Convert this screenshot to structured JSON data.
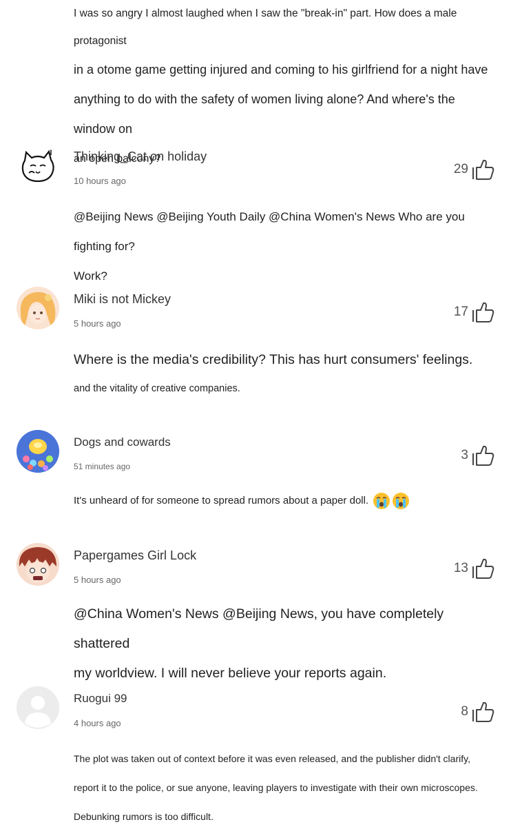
{
  "top_comment": {
    "lines": [
      "I was so angry I almost laughed when I saw the \"break-in\" part. How does a male protagonist",
      "in a otome game getting injured and coming to his girlfriend for a night have",
      "anything to do with the safety of women living alone? And where's the window on",
      "an open balcony?"
    ]
  },
  "comments": [
    {
      "username": "Thinking_Cat on holiday",
      "time": "10 hours ago",
      "likes": "29",
      "avatar_icon": "cat-doodle-icon",
      "lines": [
        "@Beijing News @Beijing Youth Daily @China Women's News Who are you fighting for?",
        "Work?"
      ]
    },
    {
      "username": "Miki is not Mickey",
      "time": "5 hours ago",
      "likes": "17",
      "avatar_icon": "anime-girl-avatar-icon",
      "lines": [
        "Where is the media's credibility? This has hurt consumers' feelings.",
        "and the vitality of creative companies."
      ]
    },
    {
      "username": "Dogs and cowards",
      "time": "51 minutes ago",
      "likes": "3",
      "avatar_icon": "colorful-blob-avatar-icon",
      "lines": [
        "It's unheard of for someone to spread rumors about a paper doll."
      ],
      "emojis": [
        "crying-face-icon",
        "crying-face-icon"
      ]
    },
    {
      "username": "Papergames Girl Lock",
      "time": "5 hours ago",
      "likes": "13",
      "avatar_icon": "anime-boy-avatar-icon",
      "lines": [
        "@China Women's News @Beijing News, you have completely shattered",
        "my worldview. I will never believe your reports again."
      ]
    },
    {
      "username": "Ruogui 99",
      "time": "4 hours ago",
      "likes": "8",
      "avatar_icon": "default-user-avatar-icon",
      "lines": [
        "The plot was taken out of context before it was even released, and the publisher didn't clarify,",
        "report it to the police, or sue anyone, leaving players to investigate with their own microscopes.",
        "Debunking rumors is too difficult."
      ]
    }
  ],
  "colors": {
    "background": "#ffffff",
    "text": "#222222",
    "meta": "#666666",
    "icon_stroke": "#444444"
  }
}
